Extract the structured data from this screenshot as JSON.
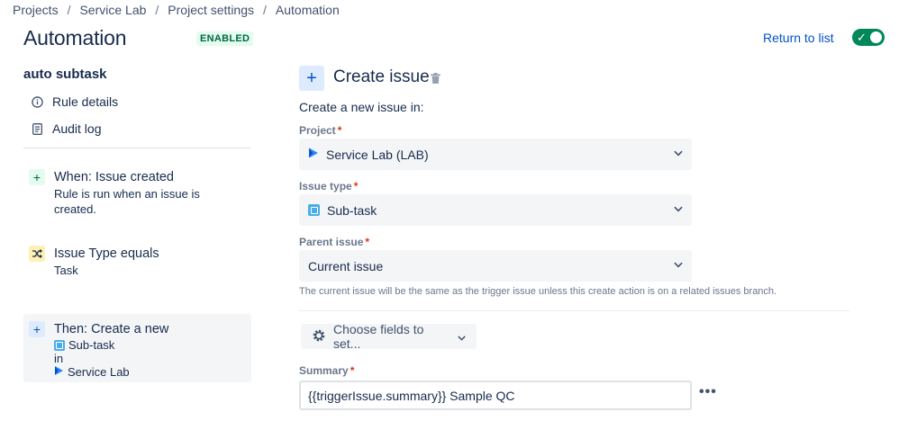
{
  "breadcrumb": {
    "items": [
      "Projects",
      "Service Lab",
      "Project settings",
      "Automation"
    ],
    "separator": "/"
  },
  "header": {
    "title": "Automation",
    "status_badge": "ENABLED",
    "return_link": "Return to list",
    "toggle_state": "on"
  },
  "sidebar": {
    "rule_name": "auto subtask",
    "nav_items": [
      {
        "label": "Rule details",
        "icon": "info-icon"
      },
      {
        "label": "Audit log",
        "icon": "document-icon"
      }
    ],
    "steps": {
      "trigger": {
        "title": "When: Issue created",
        "description": "Rule is run when an issue is created."
      },
      "condition": {
        "title": "Issue Type equals",
        "description": "Task"
      },
      "action": {
        "title": "Then: Create a new",
        "issue_type": "Sub-task",
        "connector": "in",
        "project": "Service Lab"
      }
    }
  },
  "main": {
    "action_title": "Create issue",
    "intro": "Create a new issue in:",
    "project": {
      "label": "Project",
      "required_mark": "*",
      "value": "Service Lab (LAB)"
    },
    "issue_type": {
      "label": "Issue type",
      "required_mark": "*",
      "value": "Sub-task"
    },
    "parent_issue": {
      "label": "Parent issue",
      "required_mark": "*",
      "value": "Current issue",
      "helper": "The current issue will be the same as the trigger issue unless this create action is on a related issues branch."
    },
    "fields_button": "Choose fields to set...",
    "summary": {
      "label": "Summary",
      "required_mark": "*",
      "value": "{{triggerIssue.summary}} Sample QC"
    },
    "more": "•••"
  },
  "colors": {
    "accent": "#0052CC",
    "toggle_on": "#00875A",
    "enabled_badge_bg": "#E3FCEF",
    "required": "#DE350B"
  }
}
